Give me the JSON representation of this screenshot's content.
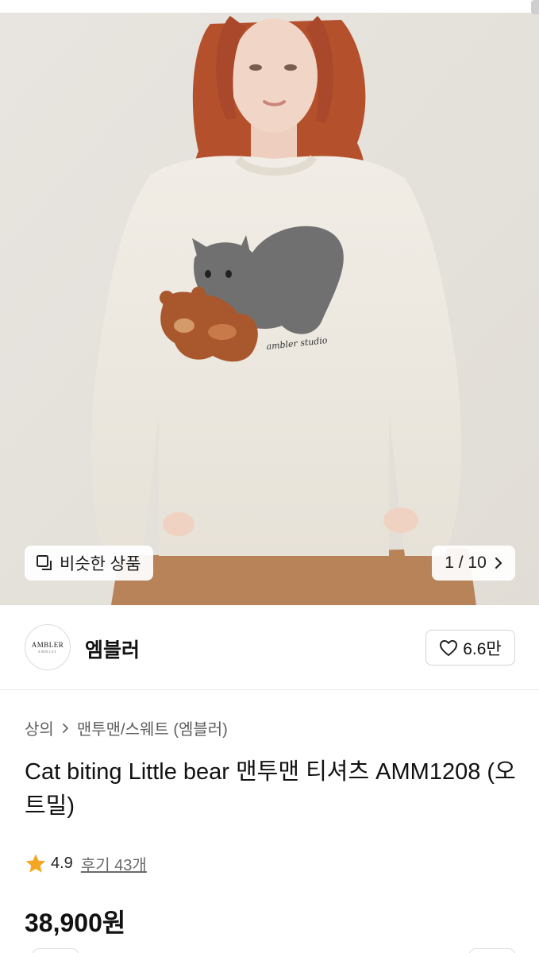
{
  "gallery": {
    "similar_label": "비슷한 상품",
    "counter": "1 / 10",
    "sweater_embroidery": "ambler studio"
  },
  "brand": {
    "logo_text": "AMBLER",
    "logo_subtext": "AMBIAT",
    "name": "엠블러",
    "like_count": "6.6만"
  },
  "breadcrumb": [
    "상의",
    "맨투맨/스웨트 (엠블러)"
  ],
  "product": {
    "title": "Cat biting Little bear 맨투맨 티셔츠 AMM1208 (오트밀)",
    "rating": "4.9",
    "reviews": "후기 43개",
    "price": "38,900원"
  },
  "colors": {
    "star": "#f5a623",
    "sweater": "#efebe3",
    "hair": "#b4512c",
    "skirt": "#b9835a"
  },
  "icons": {
    "similar": "similar-items-icon",
    "next": "chevron-right-icon",
    "like": "heart-outline-icon",
    "rating": "star-icon",
    "breadcrumb": "chevron-right-small-icon"
  }
}
